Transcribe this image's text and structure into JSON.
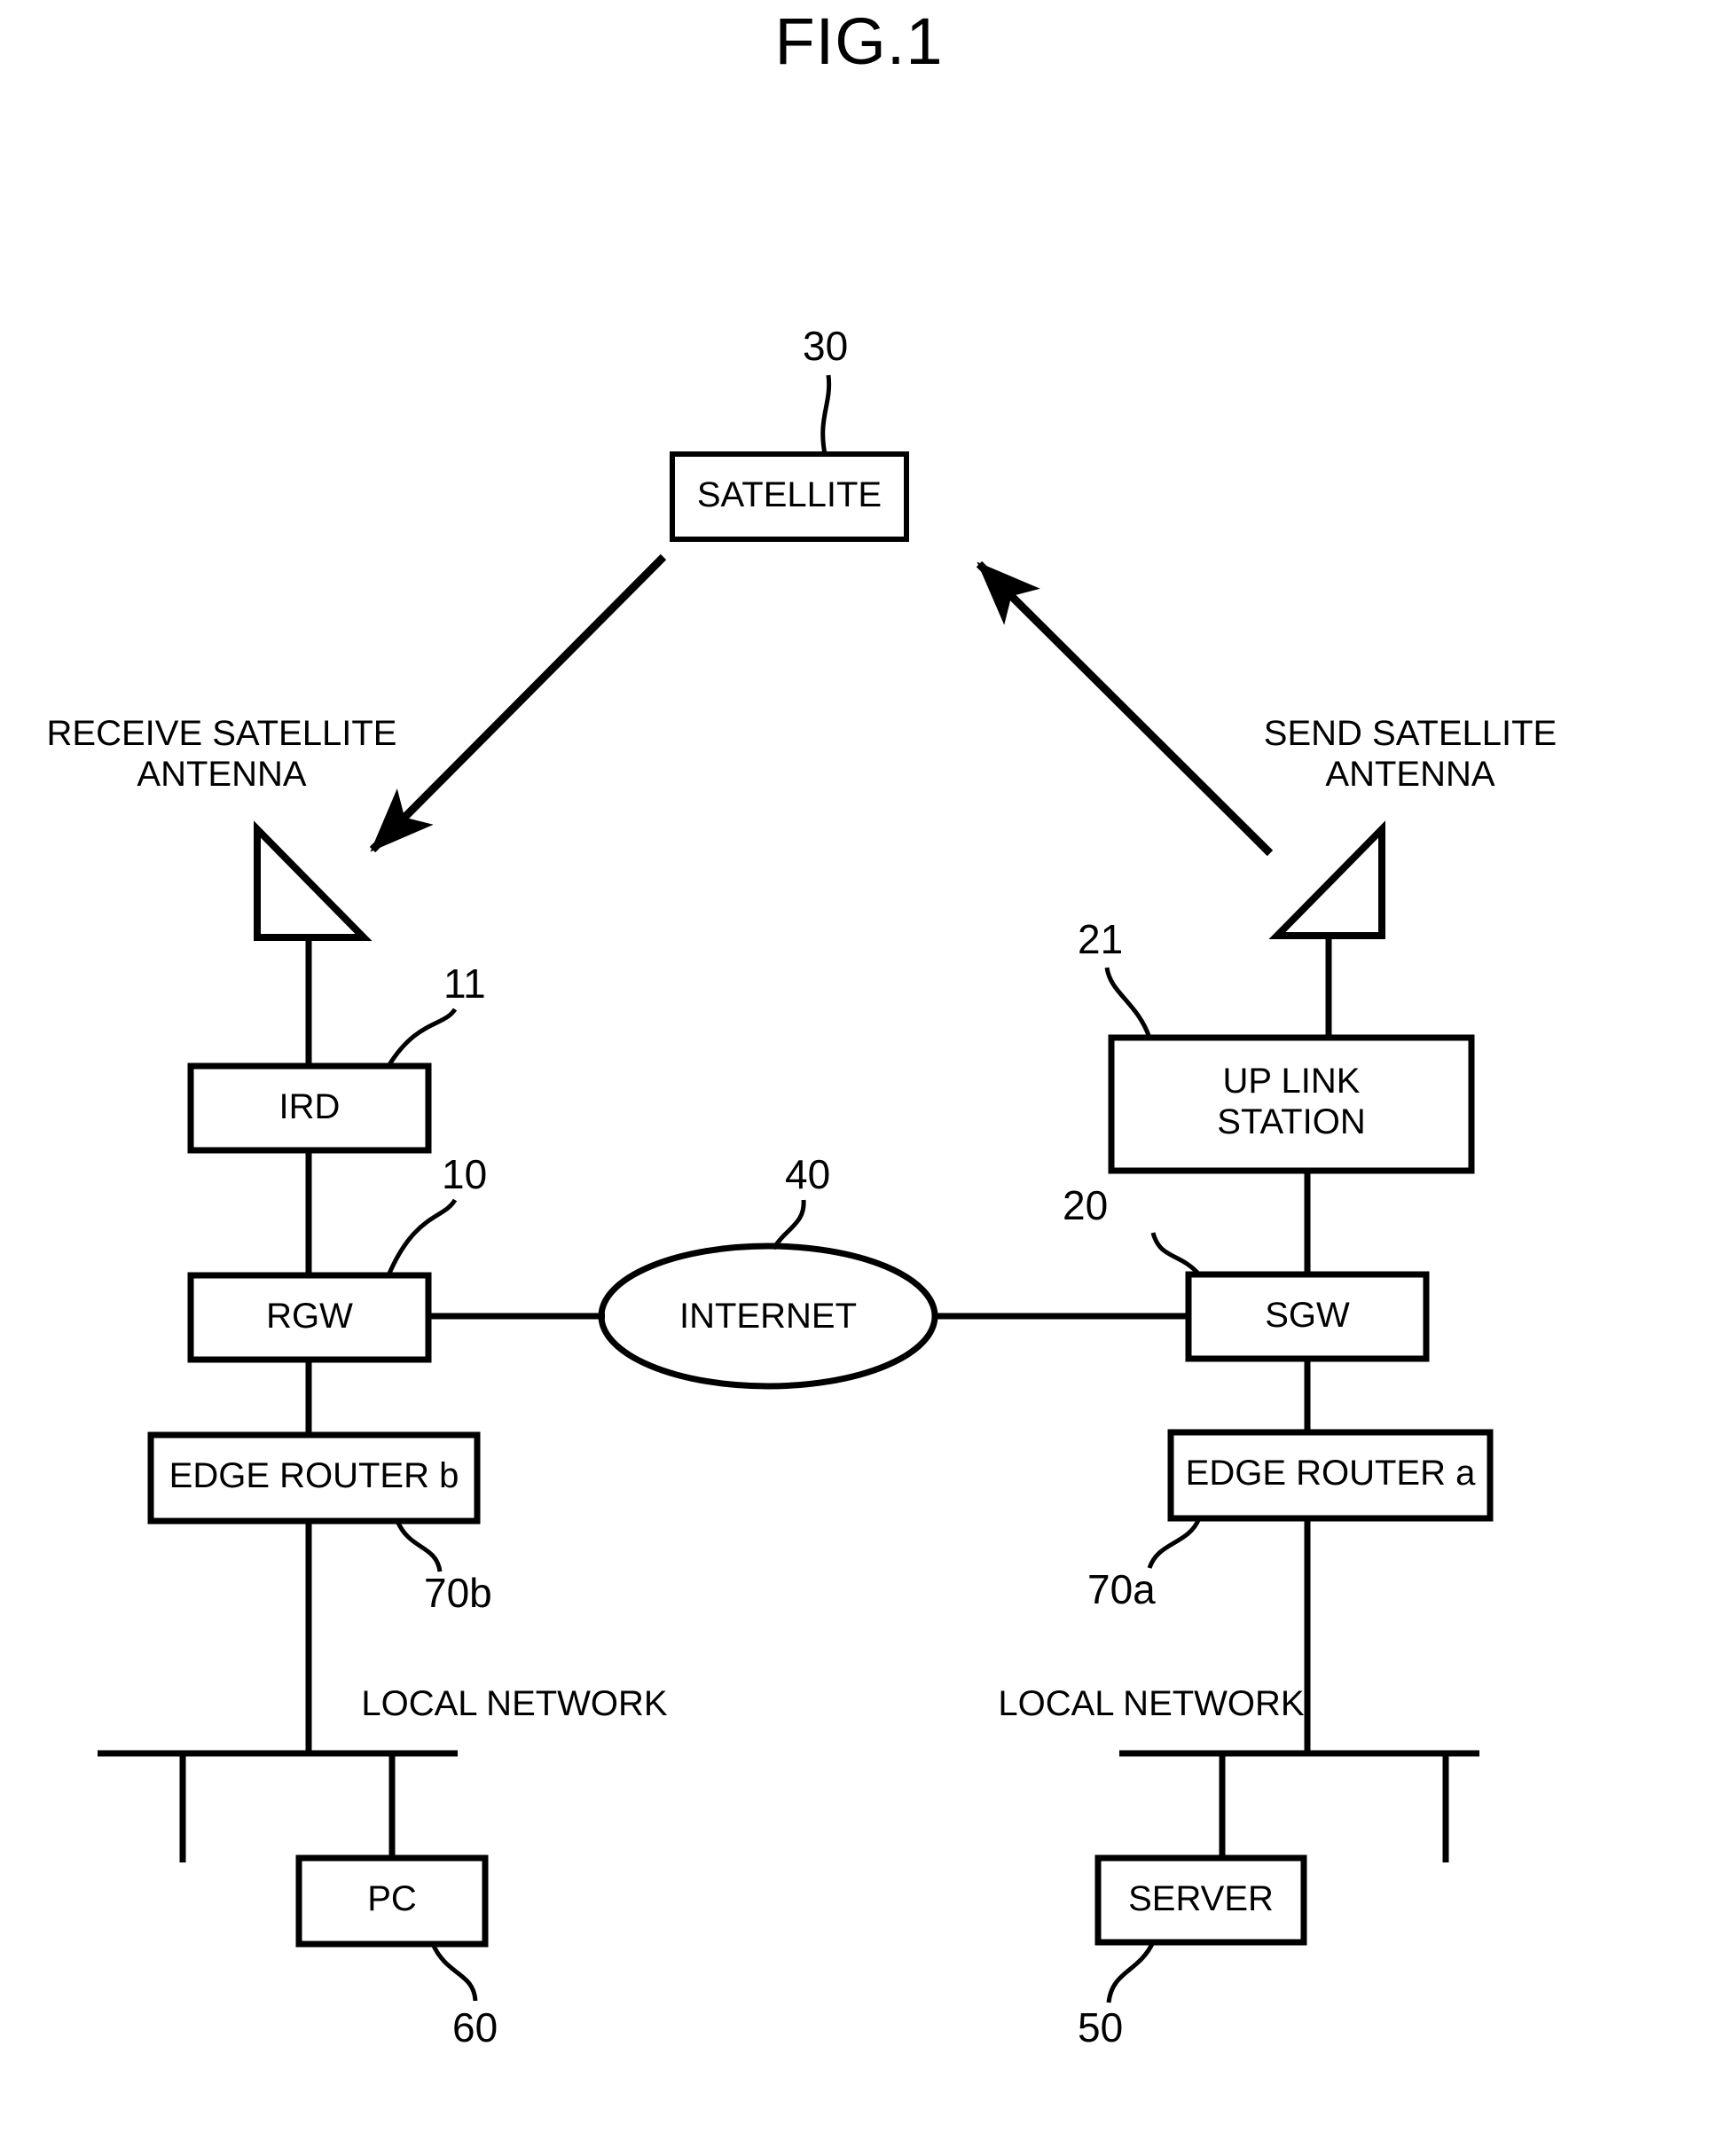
{
  "figure": {
    "title": "FIG.1",
    "type": "patent-network-diagram"
  },
  "nodes": {
    "satellite": {
      "label": "SATELLITE",
      "ref": "30"
    },
    "receive_antenna": {
      "label_line1": "RECEIVE SATELLITE",
      "label_line2": "ANTENNA"
    },
    "send_antenna": {
      "label_line1": "SEND SATELLITE",
      "label_line2": "ANTENNA"
    },
    "ird": {
      "label": "IRD",
      "ref": "11"
    },
    "rgw": {
      "label": "RGW",
      "ref": "10"
    },
    "internet": {
      "label": "INTERNET",
      "ref": "40"
    },
    "uplink_station": {
      "label_line1": "UP LINK",
      "label_line2": "STATION",
      "ref": "21"
    },
    "sgw": {
      "label": "SGW",
      "ref": "20"
    },
    "edge_router_b": {
      "label": "EDGE ROUTER b",
      "ref": "70b"
    },
    "edge_router_a": {
      "label": "EDGE ROUTER a",
      "ref": "70a"
    },
    "local_network_left": {
      "label": "LOCAL NETWORK"
    },
    "local_network_right": {
      "label": "LOCAL NETWORK"
    },
    "pc": {
      "label": "PC",
      "ref": "60"
    },
    "server": {
      "label": "SERVER",
      "ref": "50"
    }
  },
  "colors": {
    "ink": "#000000",
    "paper": "#ffffff"
  }
}
